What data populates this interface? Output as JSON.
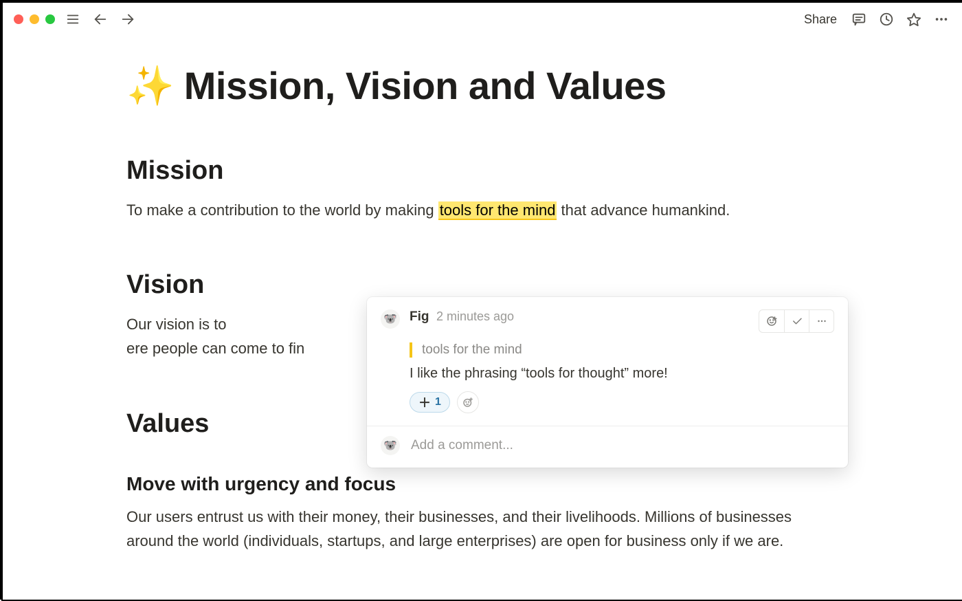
{
  "toolbar": {
    "share_label": "Share"
  },
  "page": {
    "icon": "✨",
    "title": "Mission, Vision and Values"
  },
  "sections": {
    "mission": {
      "heading": "Mission",
      "text_before": "To make a contribution to the world by making ",
      "highlight": "tools for the mind",
      "text_after": " that advance humankind."
    },
    "vision": {
      "heading": "Vision",
      "text_visible_start": "Our vision is to ",
      "text_visible_end": "ere people can come to fin"
    },
    "values": {
      "heading": "Values",
      "sub_heading": "Move with urgency and focus",
      "body": "Our users entrust us with their money, their businesses, and their livelihoods. Millions of businesses around the world (individuals, startups, and large enterprises) are open for business only if we are."
    }
  },
  "comment": {
    "author": "Fig",
    "timestamp": "2 minutes ago",
    "quoted": "tools for the mind",
    "body": "I like the phrasing “tools for thought” more!",
    "reaction_count": "1",
    "input_placeholder": "Add a comment..."
  }
}
